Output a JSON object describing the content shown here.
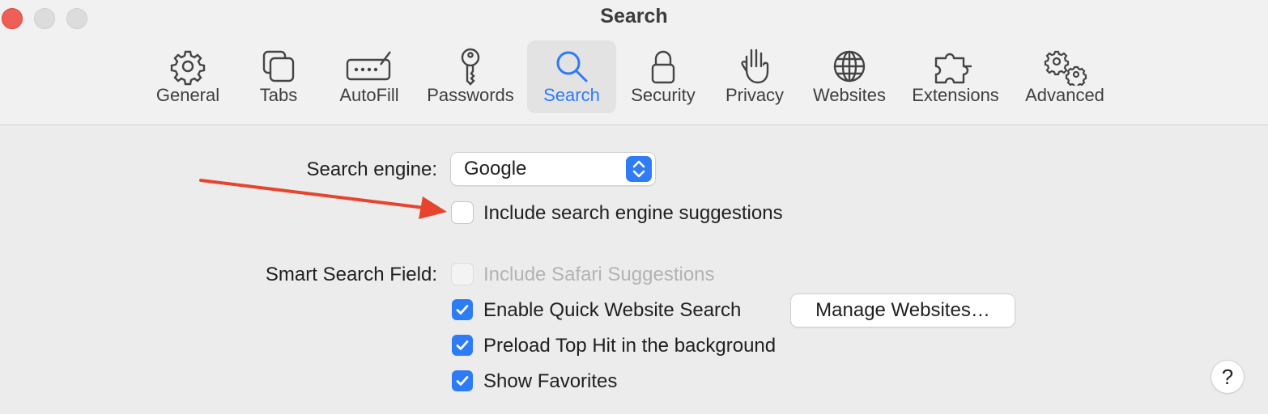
{
  "window": {
    "title": "Search"
  },
  "toolbar": {
    "items": [
      {
        "label": "General",
        "icon": "gear-icon"
      },
      {
        "label": "Tabs",
        "icon": "tabs-icon"
      },
      {
        "label": "AutoFill",
        "icon": "autofill-icon"
      },
      {
        "label": "Passwords",
        "icon": "key-icon"
      },
      {
        "label": "Search",
        "icon": "magnifier-icon",
        "active": true
      },
      {
        "label": "Security",
        "icon": "lock-icon"
      },
      {
        "label": "Privacy",
        "icon": "hand-icon"
      },
      {
        "label": "Websites",
        "icon": "globe-icon"
      },
      {
        "label": "Extensions",
        "icon": "puzzle-icon"
      },
      {
        "label": "Advanced",
        "icon": "gears-icon"
      }
    ]
  },
  "search_engine": {
    "label": "Search engine:",
    "value": "Google",
    "include_suggestions": {
      "label": "Include search engine suggestions",
      "checked": false
    }
  },
  "smart_search": {
    "label": "Smart Search Field:",
    "options": [
      {
        "label": "Include Safari Suggestions",
        "checked": false,
        "disabled": true
      },
      {
        "label": "Enable Quick Website Search",
        "checked": true
      },
      {
        "label": "Preload Top Hit in the background",
        "checked": true
      },
      {
        "label": "Show Favorites",
        "checked": true
      }
    ],
    "manage_button": "Manage Websites…"
  },
  "help": "?",
  "colors": {
    "accent": "#2d7cf6",
    "arrow": "#e8432d",
    "close": "#ee5f57"
  }
}
